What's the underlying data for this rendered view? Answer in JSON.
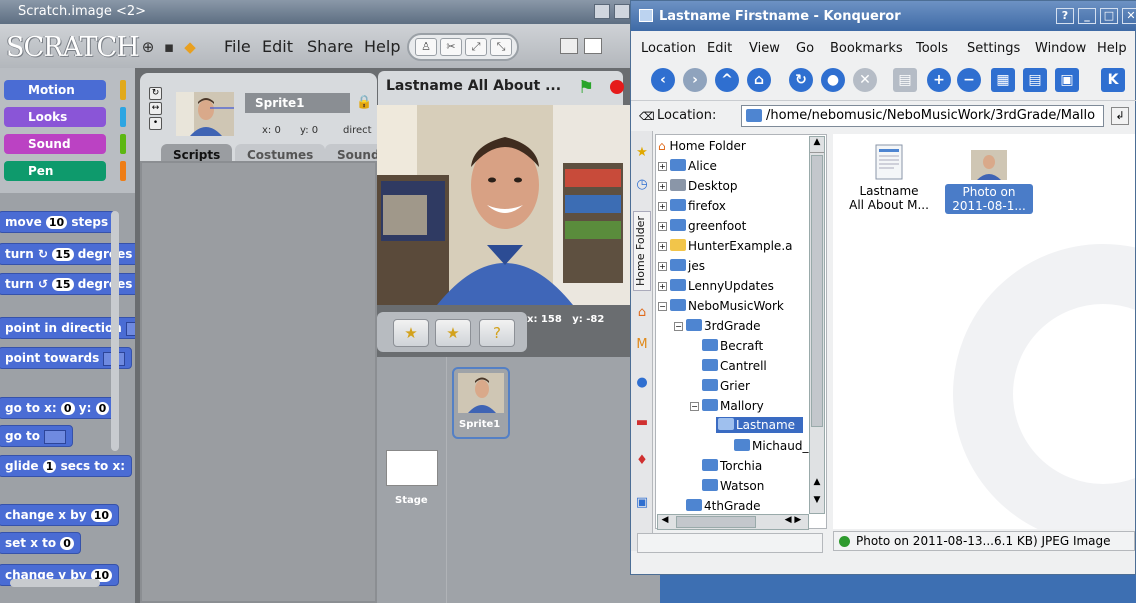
{
  "scratch": {
    "title": "Scratch.image <2>",
    "logo": "SCRATCH",
    "menus": [
      "File",
      "Edit",
      "Share",
      "Help"
    ],
    "categories": [
      {
        "label": "Motion",
        "color": "#4a6cd4"
      },
      {
        "label": "Looks",
        "color": "#8a55d7"
      },
      {
        "label": "Sound",
        "color": "#bb42c3"
      },
      {
        "label": "Pen",
        "color": "#0e9a6c"
      }
    ],
    "blocks": {
      "move": {
        "pre": "move",
        "num": "10",
        "post": "steps"
      },
      "turn_cw": {
        "pre": "turn",
        "num": "15",
        "post": "degrees"
      },
      "turn_ccw": {
        "pre": "turn",
        "num": "15",
        "post": "degrees"
      },
      "point_dir": {
        "pre": "point in direction"
      },
      "point_towards": {
        "pre": "point towards"
      },
      "goto_xy": {
        "pre": "go to x:",
        "x": "0",
        "mid": "y:",
        "y": "0"
      },
      "goto": {
        "pre": "go to"
      },
      "glide": {
        "pre": "glide",
        "num": "1",
        "post": "secs to x:"
      },
      "change_x": {
        "pre": "change x by",
        "num": "10"
      },
      "set_x": {
        "pre": "set x to",
        "num": "0"
      },
      "change_y": {
        "pre": "change y by",
        "num": "10"
      }
    },
    "sprite_name": "Sprite1",
    "x_label": "x: 0",
    "y_label": "y: 0",
    "direction_label": "direct",
    "tabs": [
      "Scripts",
      "Costumes",
      "Sounds"
    ],
    "project_title": "Lastname All About ...",
    "mouse_x": "x: 158",
    "mouse_y": "y: -82",
    "stage_label": "Stage",
    "sprite_tile_label": "Sprite1"
  },
  "konqueror": {
    "title": "Lastname Firstname - Konqueror",
    "menus": [
      "Location",
      "Edit",
      "View",
      "Go",
      "Bookmarks",
      "Tools",
      "Settings",
      "Window",
      "Help"
    ],
    "location_label": "Location:",
    "location_path": "/home/nebomusic/NeboMusicWork/3rdGrade/Mallo",
    "side_tab_label": "Home Folder",
    "tree": [
      {
        "label": "Home Folder"
      },
      {
        "label": "Alice"
      },
      {
        "label": "Desktop"
      },
      {
        "label": "firefox"
      },
      {
        "label": "greenfoot"
      },
      {
        "label": "HunterExample.a"
      },
      {
        "label": "jes"
      },
      {
        "label": "LennyUpdates"
      },
      {
        "label": "NeboMusicWork"
      },
      {
        "label": "3rdGrade"
      },
      {
        "label": "Becraft"
      },
      {
        "label": "Cantrell"
      },
      {
        "label": "Grier"
      },
      {
        "label": "Mallory"
      },
      {
        "label": "Lastname"
      },
      {
        "label": "Michaud_"
      },
      {
        "label": "Torchia"
      },
      {
        "label": "Watson"
      },
      {
        "label": "4thGrade"
      }
    ],
    "files": [
      {
        "line1": "Lastname",
        "line2": "All About M..."
      },
      {
        "line1": "Photo on",
        "line2": "2011-08-1..."
      }
    ],
    "status": "Photo on 2011-08-13...6.1 KB) JPEG Image"
  }
}
